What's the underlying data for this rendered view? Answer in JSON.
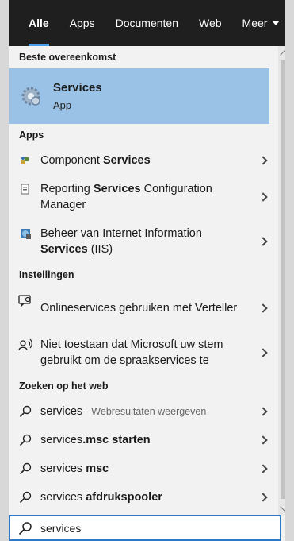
{
  "tabs": [
    {
      "label": "Alle",
      "active": true
    },
    {
      "label": "Apps"
    },
    {
      "label": "Documenten"
    },
    {
      "label": "Web"
    },
    {
      "label": "Meer"
    }
  ],
  "best_match": {
    "header": "Beste overeenkomst",
    "title": "Services",
    "subtitle": "App",
    "icon": "gear-services-icon"
  },
  "apps": {
    "header": "Apps",
    "items": [
      {
        "pre": "Component ",
        "bold": "Services",
        "post": "",
        "icon": "component-services-icon"
      },
      {
        "pre": "Reporting ",
        "bold": "Services",
        "post": " Configuration Manager",
        "icon": "reporting-services-icon"
      },
      {
        "pre": "Beheer van Internet Information ",
        "bold": "Services",
        "post": " (IIS)",
        "icon": "iis-icon"
      }
    ]
  },
  "settings": {
    "header": "Instellingen",
    "items": [
      {
        "text": "Onlineservices gebruiken met Verteller",
        "icon": "narrator-icon"
      },
      {
        "text": "Niet toestaan dat Microsoft uw stem gebruikt om de spraakservices te",
        "icon": "speech-icon"
      }
    ]
  },
  "web": {
    "header": "Zoeken op het web",
    "items": [
      {
        "pre": "services",
        "bold": "",
        "muted": " - Webresultaten weergeven"
      },
      {
        "pre": "services",
        "bold": ".msc starten",
        "muted": ""
      },
      {
        "pre": "services ",
        "bold": "msc",
        "muted": ""
      },
      {
        "pre": "services ",
        "bold": "afdrukspooler",
        "muted": ""
      }
    ]
  },
  "search": {
    "value": "services",
    "icon": "search-icon"
  },
  "colors": {
    "accent": "#2b78c9",
    "highlight": "#99c2e6",
    "tabbar": "#1f1f1f"
  }
}
